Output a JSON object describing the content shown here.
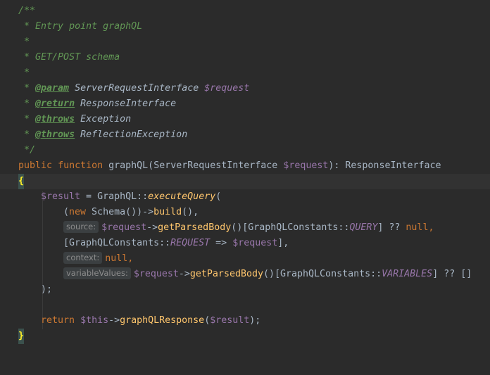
{
  "editor": {
    "doc": {
      "open": "/**",
      "star": "*",
      "summary": "Entry point graphQL",
      "note": "GET/POST schema",
      "param_tag": "@param",
      "param_type": "ServerRequestInterface",
      "param_var": "$request",
      "return_tag": "@return",
      "return_type": "ResponseInterface",
      "throws_tag": "@throws",
      "throws1": "Exception",
      "throws2": "ReflectionException",
      "close": "*/"
    },
    "signature": {
      "public": "public",
      "function": "function",
      "name": "graphQL",
      "open_paren": "(",
      "param_type": "ServerRequestInterface",
      "param_var": "$request",
      "close_paren": "): ",
      "return_type": "ResponseInterface"
    },
    "open_brace": "{",
    "close_brace": "}",
    "body": {
      "result_var": "$result",
      "assign": " = ",
      "class": "GraphQL",
      "scope": "::",
      "method": "executeQuery",
      "paren_open": "(",
      "schema_open": "(",
      "new_kw": "new",
      "schema_class": " Schema())->",
      "build": "build",
      "build_tail": "(),",
      "hint_source": "source:",
      "request_var": "$request",
      "arrow": "->",
      "getParsedBody": "getParsedBody",
      "gpb_tail": "()[",
      "constants_class": "GraphQLConstants",
      "query_const": "QUERY",
      "query_tail": "] ?? ",
      "null": "null",
      "comma": ",",
      "request_const": "REQUEST",
      "map_open": "[",
      "map_arrow": " => ",
      "map_close": "],",
      "hint_context": "context:",
      "hint_variables": "variableValues:",
      "variables_const": "VARIABLES",
      "variables_tail": "] ?? []",
      "close_call": ");",
      "return_kw": "return",
      "this_var": "$this",
      "response_method": "graphQLResponse",
      "response_open": "(",
      "response_close": ");"
    }
  },
  "colors": {
    "background": "#2b2b2b",
    "doc_comment": "#629755",
    "keyword": "#cc7832",
    "function": "#ffc66d",
    "variable": "#9876aa",
    "text": "#a9b7c6"
  }
}
